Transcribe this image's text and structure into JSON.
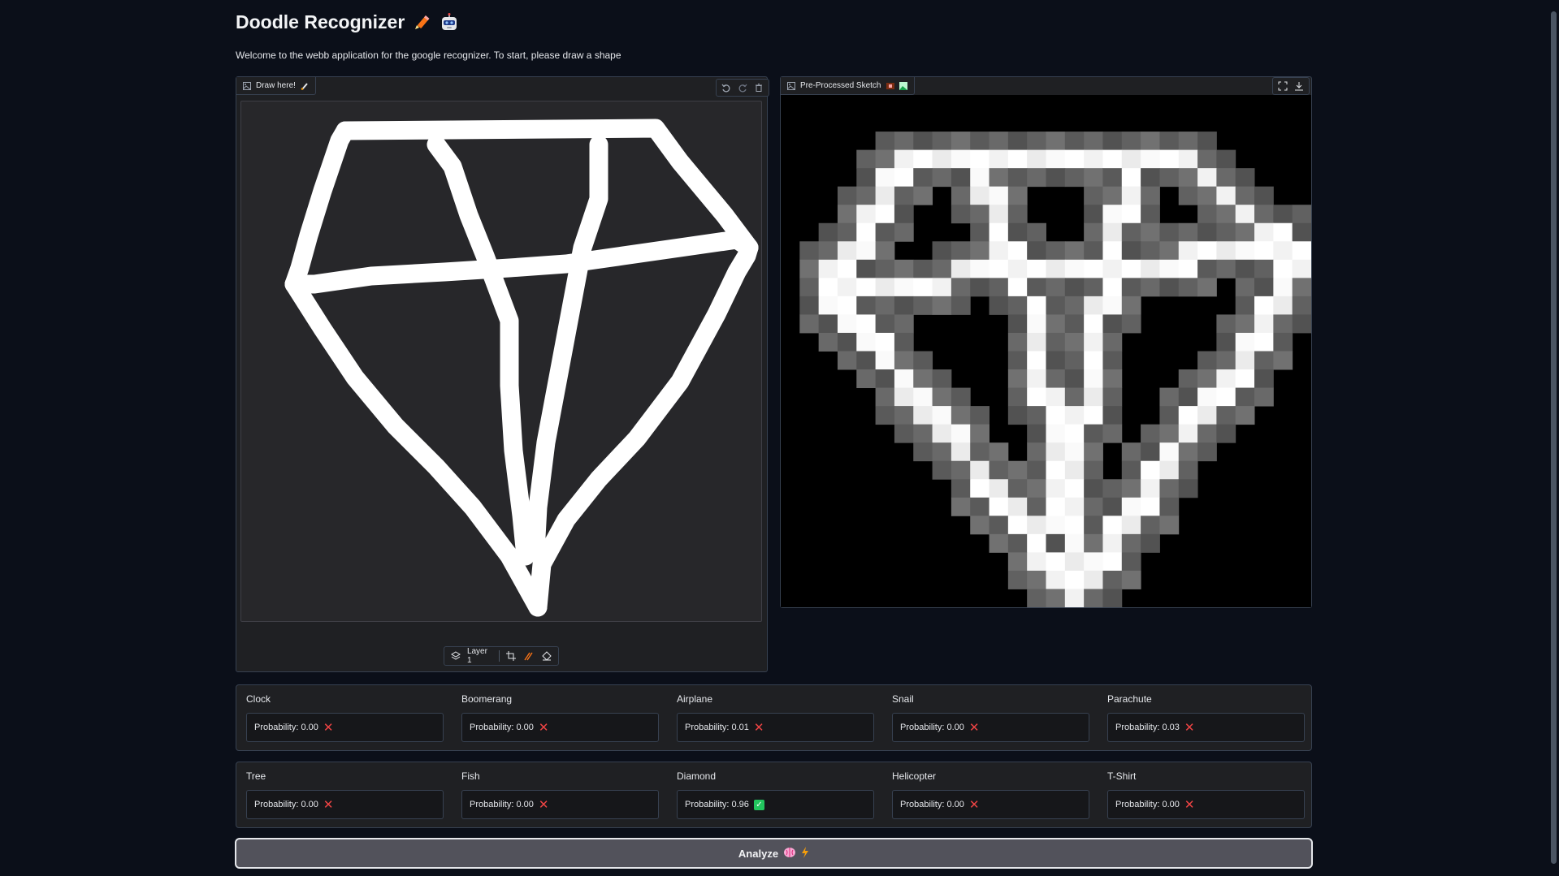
{
  "app": {
    "title": "Doodle Recognizer",
    "subtitle": "Welcome to the webb application for the google recognizer. To start, please draw a shape"
  },
  "sketchpad": {
    "label": "Draw here!",
    "layer_label": "Layer 1"
  },
  "preview": {
    "label": "Pre-Processed Sketch"
  },
  "predictions_row1": [
    {
      "name": "Clock",
      "text": "Probability: 0.00",
      "status": "x"
    },
    {
      "name": "Boomerang",
      "text": "Probability: 0.00",
      "status": "x"
    },
    {
      "name": "Airplane",
      "text": "Probability: 0.01",
      "status": "x"
    },
    {
      "name": "Snail",
      "text": "Probability: 0.00",
      "status": "x"
    },
    {
      "name": "Parachute",
      "text": "Probability: 0.03",
      "status": "x"
    }
  ],
  "predictions_row2": [
    {
      "name": "Tree",
      "text": "Probability: 0.00",
      "status": "x"
    },
    {
      "name": "Fish",
      "text": "Probability: 0.00",
      "status": "x"
    },
    {
      "name": "Diamond",
      "text": "Probability: 0.96",
      "status": "check"
    },
    {
      "name": "Helicopter",
      "text": "Probability: 0.00",
      "status": "x"
    },
    {
      "name": "T-Shirt",
      "text": "Probability: 0.00",
      "status": "x"
    }
  ],
  "analyze_button": {
    "label": "Analyze"
  },
  "colors": {
    "background": "#0b0f19",
    "panel": "#1f2023",
    "reject": "#ef4444",
    "accept": "#22c55e"
  }
}
